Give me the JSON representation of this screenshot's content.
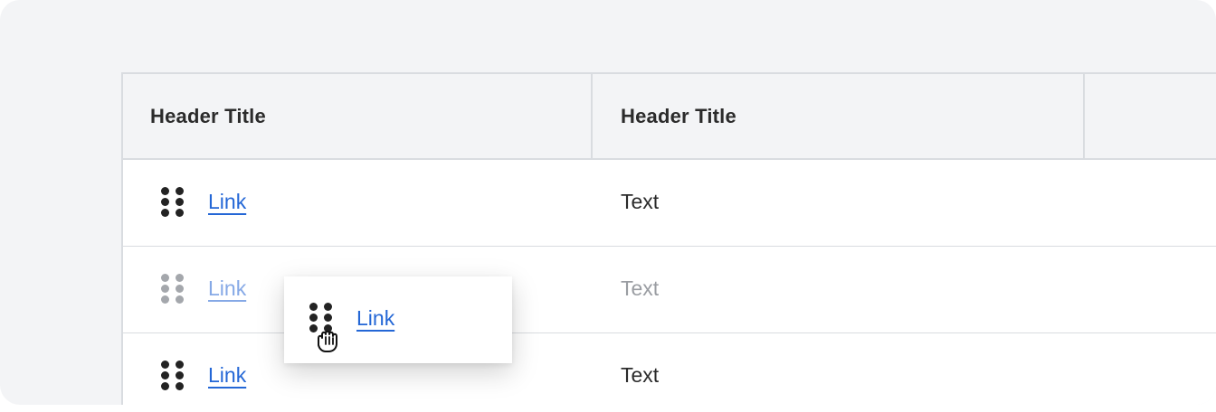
{
  "table": {
    "headers": [
      "Header Title",
      "Header Title"
    ],
    "rows": [
      {
        "link": "Link",
        "text": "Text",
        "state": "normal"
      },
      {
        "link": "Link",
        "text": "Text",
        "state": "placeholder"
      },
      {
        "link": "Link",
        "text": "Text",
        "state": "normal"
      }
    ]
  },
  "drag_preview": {
    "link": "Link"
  },
  "icons": {
    "drag_handle": "drag-handle-icon",
    "cursor": "grab-cursor-icon"
  },
  "colors": {
    "link": "#2467d6",
    "header_bg": "#f3f4f6",
    "border": "#d9dce0"
  }
}
